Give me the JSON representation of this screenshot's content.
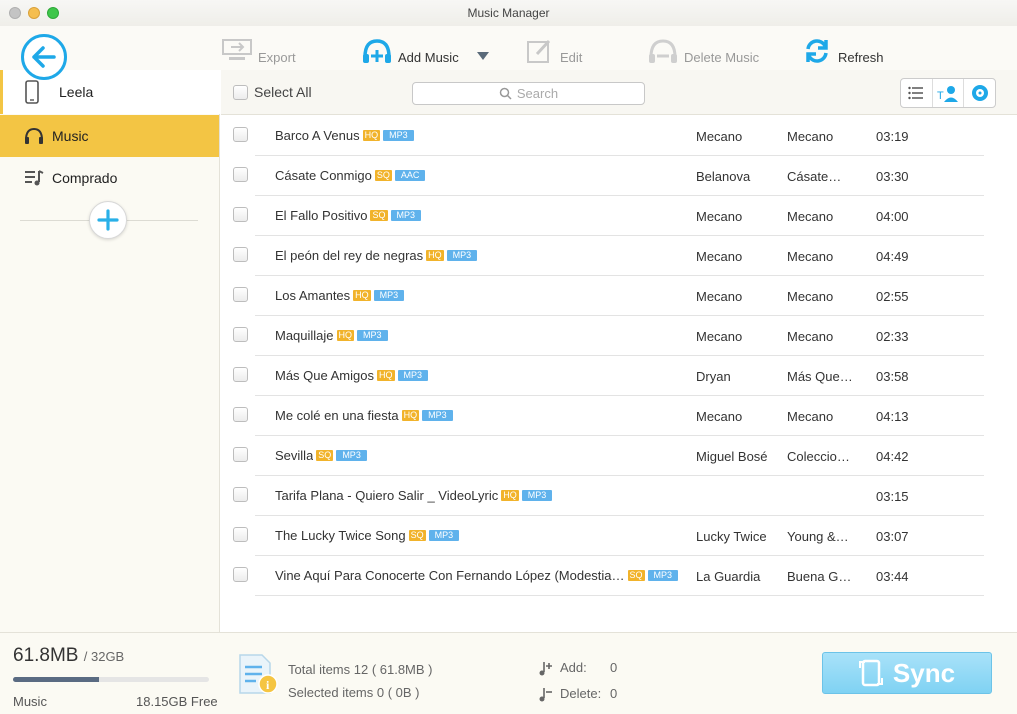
{
  "window": {
    "title": "Music Manager"
  },
  "toolbar": {
    "export_label": "Export",
    "add_music_label": "Add Music",
    "edit_label": "Edit",
    "delete_music_label": "Delete Music",
    "refresh_label": "Refresh"
  },
  "sidebar": {
    "device_name": "Leela",
    "items": [
      {
        "label": "Music",
        "icon": "headphones-icon",
        "active": true
      },
      {
        "label": "Comprado",
        "icon": "playlist-icon",
        "active": false
      }
    ]
  },
  "list": {
    "select_all_label": "Select All",
    "search_placeholder": "Search",
    "rows": [
      {
        "title": "Barco A Venus",
        "quality": "HQ",
        "format": "MP3",
        "artist": "Mecano",
        "album": "Mecano",
        "duration": "03:19"
      },
      {
        "title": "Cásate Conmigo",
        "quality": "SQ",
        "format": "AAC",
        "artist": "Belanova",
        "album": "Cásate…",
        "duration": "03:30"
      },
      {
        "title": "El Fallo Positivo",
        "quality": "SQ",
        "format": "MP3",
        "artist": "Mecano",
        "album": "Mecano",
        "duration": "04:00"
      },
      {
        "title": "El peón del rey de negras",
        "quality": "HQ",
        "format": "MP3",
        "artist": "Mecano",
        "album": "Mecano",
        "duration": "04:49"
      },
      {
        "title": "Los Amantes",
        "quality": "HQ",
        "format": "MP3",
        "artist": "Mecano",
        "album": "Mecano",
        "duration": "02:55"
      },
      {
        "title": "Maquillaje",
        "quality": "HQ",
        "format": "MP3",
        "artist": "Mecano",
        "album": "Mecano",
        "duration": "02:33"
      },
      {
        "title": "Más Que Amigos",
        "quality": "HQ",
        "format": "MP3",
        "artist": "Dryan",
        "album": "Más Que…",
        "duration": "03:58"
      },
      {
        "title": "Me colé en una fiesta",
        "quality": "HQ",
        "format": "MP3",
        "artist": "Mecano",
        "album": "Mecano",
        "duration": "04:13"
      },
      {
        "title": "Sevilla",
        "quality": "SQ",
        "format": "MP3",
        "artist": "Miguel Bosé",
        "album": "Coleccio…",
        "duration": "04:42"
      },
      {
        "title": "Tarifa Plana - Quiero Salir _ VideoLyric",
        "quality": "HQ",
        "format": "MP3",
        "artist": "",
        "album": "",
        "duration": "03:15"
      },
      {
        "title": "The Lucky Twice Song",
        "quality": "SQ",
        "format": "MP3",
        "artist": "Lucky Twice",
        "album": "Young &…",
        "duration": "03:07"
      },
      {
        "title": "Vine Aquí Para Conocerte Con Fernando López (Modestia…",
        "quality": "SQ",
        "format": "MP3",
        "artist": "La Guardia",
        "album": "Buena G…",
        "duration": "03:44"
      }
    ]
  },
  "footer": {
    "storage_used": "61.8MB",
    "storage_total": "/ 32GB",
    "storage_fraction": 0.44,
    "storage_category": "Music",
    "storage_free": "18.15GB Free",
    "total_items": "Total items 12 ( 61.8MB )",
    "selected_items": "Selected items 0 ( 0B )",
    "add_label": "Add:",
    "add_count": "0",
    "delete_label": "Delete:",
    "delete_count": "0",
    "sync_label": "Sync"
  },
  "colors": {
    "accent_blue": "#1ea8e8",
    "sidebar_active": "#f3c544",
    "quality_badge": "#f1b32b",
    "format_badge": "#5fb2ec",
    "sync_button": "#8fd6f5"
  }
}
